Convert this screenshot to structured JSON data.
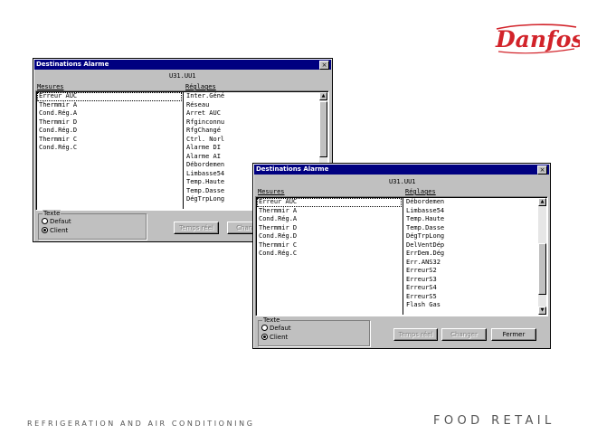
{
  "brand": {
    "logo_text": "Danfoss",
    "logo_color": "#d2232a"
  },
  "footer": {
    "left": "REFRIGERATION AND AIR CONDITIONING",
    "right": "FOOD RETAIL"
  },
  "colors": {
    "titlebar": "#000080",
    "dialog": "#c0c0c0"
  },
  "dialog1": {
    "title": "Destinations Alarme",
    "device_id": "U31.UU1",
    "col_mesures": "Mesures",
    "col_reglages": "Réglages",
    "mesures": [
      "Erreur AUC",
      "Thermmir A",
      "Cond.Rég.A",
      "Thermmir D",
      "Cond.Rég.D",
      "Thermmir C",
      "Cond.Rég.C"
    ],
    "reglages": [
      "Inter.Géné",
      "Réseau",
      "Arret AUC",
      "Rfginconnu",
      "RfgChangé",
      "Ctrl. Norl",
      "Alarme DI",
      "Alarme AI",
      "Débordemen",
      "Limbasse54",
      "Temp.Haute",
      "Temp.Dasse",
      "DégTrpLong"
    ],
    "group_label": "Texte",
    "radio_default": "Defaut",
    "radio_client": "Client",
    "btn_temps_reel": "Temps réel",
    "btn_changer": "Changer"
  },
  "dialog2": {
    "title": "Destinations Alarme",
    "device_id": "U31.UU1",
    "col_mesures": "Mesures",
    "col_reglages": "Réglages",
    "mesures": [
      "Erreur AUC",
      "Thermmir A",
      "Cond.Rég.A",
      "Thermmir D",
      "Cond.Rég.D",
      "Thermmir C",
      "Cond.Rég.C"
    ],
    "reglages": [
      "Débordemen",
      "Limbasse54",
      "Temp.Haute",
      "Temp.Dasse",
      "DégTrpLong",
      "DelVentDép",
      "ErrDem.Dég",
      "Err.ANS32",
      "ErreurS2",
      "ErreurS3",
      "ErreurS4",
      "ErreurS5",
      "Flash Gas"
    ],
    "group_label": "Texte",
    "radio_default": "Defaut",
    "radio_client": "Client",
    "btn_temps_reel": "Temps réel",
    "btn_changer": "Changer",
    "btn_fermer": "Fermer"
  }
}
